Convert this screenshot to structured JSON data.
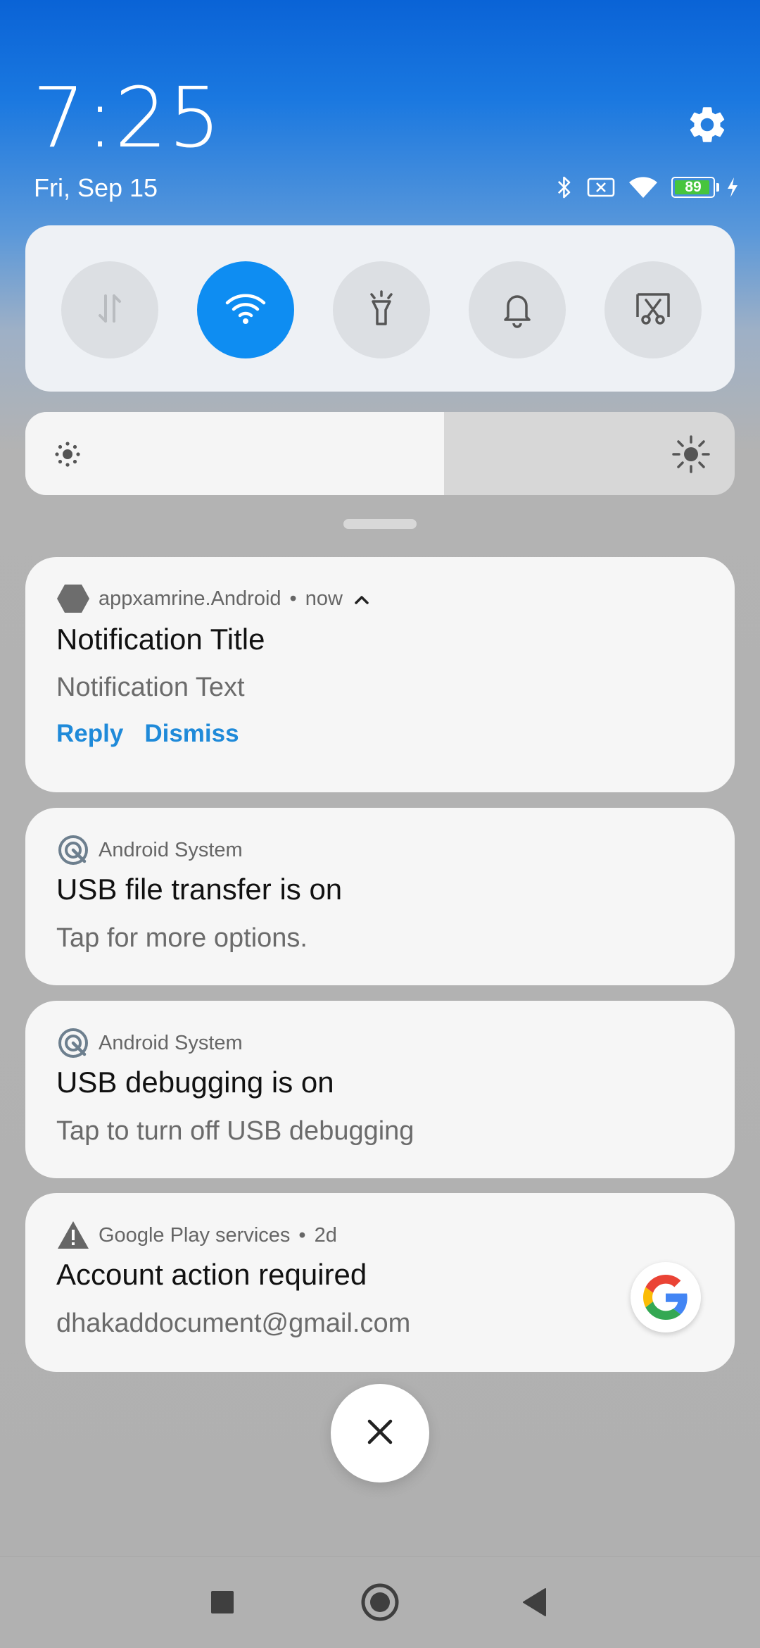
{
  "status": {
    "time": "7:25",
    "date": "Fri, Sep 15",
    "battery": "89"
  },
  "quick_toggles": [
    {
      "name": "mobile-data",
      "icon": "data-transfer-icon",
      "active": false
    },
    {
      "name": "wifi",
      "icon": "wifi-icon",
      "active": true
    },
    {
      "name": "flashlight",
      "icon": "flashlight-icon",
      "active": false
    },
    {
      "name": "sound",
      "icon": "bell-icon",
      "active": false
    },
    {
      "name": "screenshot",
      "icon": "screenshot-icon",
      "active": false
    }
  ],
  "brightness": {
    "level": 0.59
  },
  "notifications": [
    {
      "app": "appxamrine.Android",
      "time": "now",
      "title": "Notification Title",
      "text": "Notification Text",
      "actions": [
        "Reply",
        "Dismiss"
      ]
    },
    {
      "app": "Android System",
      "title": "USB file transfer is on",
      "text": "Tap for more options."
    },
    {
      "app": "Android System",
      "title": "USB debugging is on",
      "text": "Tap to turn off USB debugging"
    },
    {
      "app": "Google Play services",
      "time": "2d",
      "title": "Account action required",
      "text": "dhakaddocument@gmail.com"
    }
  ],
  "colors": {
    "accent": "#0e8df2",
    "action_text": "#1f8ad9"
  }
}
